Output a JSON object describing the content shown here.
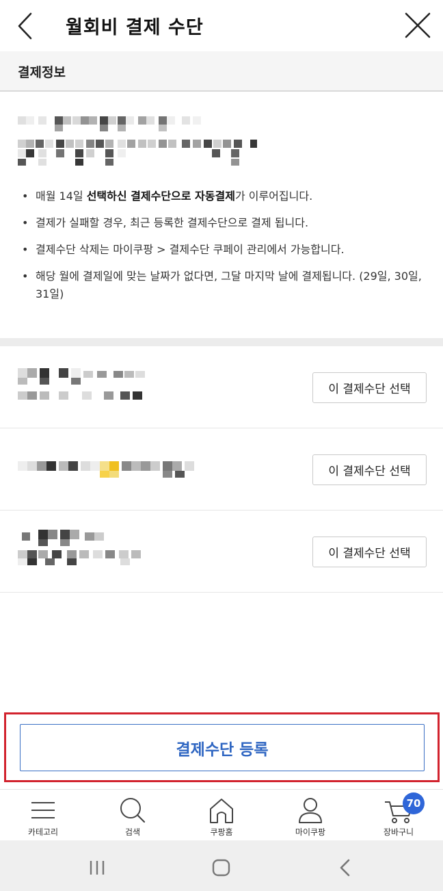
{
  "header": {
    "title": "월회비 결제 수단",
    "back_icon": "chevron-left-icon",
    "close_icon": "close-icon"
  },
  "section": {
    "title": "결제정보"
  },
  "notes": [
    {
      "pre": "매월 14일 ",
      "bold": "선택하신 결제수단으로 자동결제",
      "post": "가 이루어집니다."
    },
    {
      "pre": "결제가 실패할 경우, 최근 등록한 결제수단으로 결제 됩니다.",
      "bold": "",
      "post": ""
    },
    {
      "pre": "결제수단 삭제는 마이쿠팡 > 결제수단 쿠페이 관리에서 가능합니다.",
      "bold": "",
      "post": ""
    },
    {
      "pre": "해당 월에 결제일에 맞는 날짜가 없다면, 그달 마지막 날에 결제됩니다. (29일, 30일, 31일)",
      "bold": "",
      "post": ""
    }
  ],
  "methods": [
    {
      "select_label": "이 결제수단 선택"
    },
    {
      "select_label": "이 결제수단 선택"
    },
    {
      "select_label": "이 결제수단 선택"
    }
  ],
  "register": {
    "label": "결제수단 등록"
  },
  "tabbar": {
    "items": [
      {
        "label": "카테고리",
        "icon": "menu-icon"
      },
      {
        "label": "검색",
        "icon": "search-icon"
      },
      {
        "label": "쿠팡홈",
        "icon": "home-icon"
      },
      {
        "label": "마이쿠팡",
        "icon": "user-icon"
      },
      {
        "label": "장바구니",
        "icon": "cart-icon"
      }
    ],
    "cart_count": "70"
  },
  "system_nav": {
    "items": [
      "recent-apps-icon",
      "home-button-icon",
      "back-icon"
    ]
  },
  "colors": {
    "accent_blue": "#2f66c2",
    "highlight_red": "#d2232e",
    "badge_blue": "#2f66d8"
  }
}
